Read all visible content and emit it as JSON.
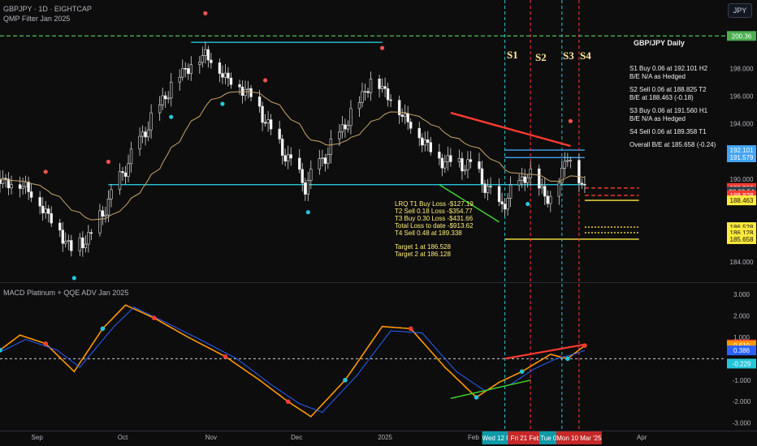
{
  "header": {
    "symbol_line": "GBPJPY · 1D · EIGHTCAP",
    "indicator_line": "QMP Filter Jan 2025",
    "macd_title": "MACD Platinum + QQE ADV Jan 2025",
    "currency_button": "JPY"
  },
  "notes": {
    "title": "GBP/JPY Daily",
    "lines": [
      "S1 Buy 0.06 at 192.101 H2",
      "B/E N/A as Hedged",
      "",
      "S2 Sell 0.06 at 188.825 T2",
      "B/E at 188.463 (-0.18)",
      "",
      "S3 Buy 0.06 at 191.560 H1",
      "B/E N/A as Hedged",
      "",
      "S4 Sell 0.06 at 189.358 T1",
      "",
      "Overall B/E at 185.658 (-0.24)"
    ]
  },
  "loss_box": {
    "lines": [
      "LRQ T1 Buy Loss -$127.19",
      "T2 Sell 0.18 Loss -$354.77",
      "T3 Buy 0.30 Loss -$431.66",
      "Total Loss to date -$913.62",
      "T4 Sell 0.48 at 189.338",
      "",
      "Target 1 at 186.528",
      "Target 2 at 186.128"
    ]
  },
  "signals": [
    "S1",
    "S2",
    "S3",
    "S4"
  ],
  "colors": {
    "up": "#d8d8d8",
    "down": "#ffffff",
    "ema": "#c9a66b",
    "cyan": "#26c6da",
    "red": "#ff3b30",
    "green": "#3ddc2f",
    "yellow": "#ffeb3b",
    "blue_line": "#42a5f5",
    "macd": "#ff9800",
    "signal": "#2962ff"
  },
  "chart_data": [
    {
      "type": "candlestick",
      "title": "GBPJPY · 1D · EIGHTCAP",
      "ylim": [
        183.6,
        201.2
      ],
      "y_ticks": [
        184.0,
        190.0,
        192.0,
        194.0,
        196.0,
        198.0
      ],
      "x_tick_labels": [
        "Sep",
        "Oct",
        "Nov",
        "Dec",
        "2025",
        "Feb",
        "Apr"
      ],
      "x_tick_dates": [
        "2024-09-01",
        "2024-10-01",
        "2024-11-01",
        "2024-12-01",
        "2025-01-01",
        "2025-02-01",
        "2025-04-01"
      ],
      "close_waypoints": [
        {
          "date": "2024-08-19",
          "value": 190.0
        },
        {
          "date": "2024-08-28",
          "value": 189.6
        },
        {
          "date": "2024-09-06",
          "value": 187.2
        },
        {
          "date": "2024-09-13",
          "value": 185.0
        },
        {
          "date": "2024-09-20",
          "value": 186.0
        },
        {
          "date": "2024-10-01",
          "value": 190.5
        },
        {
          "date": "2024-10-10",
          "value": 194.0
        },
        {
          "date": "2024-10-20",
          "value": 197.5
        },
        {
          "date": "2024-10-30",
          "value": 199.2
        },
        {
          "date": "2024-11-06",
          "value": 197.5
        },
        {
          "date": "2024-11-15",
          "value": 196.2
        },
        {
          "date": "2024-11-25",
          "value": 192.5
        },
        {
          "date": "2024-12-04",
          "value": 189.6
        },
        {
          "date": "2024-12-15",
          "value": 193.0
        },
        {
          "date": "2024-12-28",
          "value": 197.5
        },
        {
          "date": "2025-01-10",
          "value": 194.0
        },
        {
          "date": "2025-01-20",
          "value": 191.5
        },
        {
          "date": "2025-02-01",
          "value": 191.0
        },
        {
          "date": "2025-02-10",
          "value": 188.0
        },
        {
          "date": "2025-02-20",
          "value": 190.5
        },
        {
          "date": "2025-02-28",
          "value": 188.5
        },
        {
          "date": "2025-03-06",
          "value": 191.8
        },
        {
          "date": "2025-03-12",
          "value": 189.4
        }
      ],
      "price_labels": [
        {
          "text": "192.101",
          "value": 192.101,
          "color": "#42a5f5"
        },
        {
          "text": "191.579",
          "value": 191.579,
          "color": "#42a5f5"
        },
        {
          "text": "189.360",
          "value": 189.36,
          "color": "#ff3b30"
        },
        {
          "text": "20:09:54",
          "value": 189.1,
          "color": "#3a3e48"
        },
        {
          "text": "188.828",
          "value": 188.828,
          "color": "#ff3b30"
        },
        {
          "text": "188.463",
          "value": 188.463,
          "color": "#ffeb3b"
        },
        {
          "text": "186.528",
          "value": 186.528,
          "color": "#ffeb3b"
        },
        {
          "text": "186.128",
          "value": 186.128,
          "color": "#ffeb3b"
        },
        {
          "text": "185.658",
          "value": 185.658,
          "color": "#ffeb3b"
        },
        {
          "text": "200.36",
          "value": 200.36,
          "color": "#4caf50"
        }
      ],
      "levels": [
        {
          "name": "top-resistance",
          "value": 199.9,
          "from": "2024-10-25",
          "to": "2024-12-31",
          "color": "#26c6da"
        },
        {
          "name": "support",
          "value": 189.6,
          "from": "2024-09-26",
          "to": "2025-03-12",
          "color": "#26c6da"
        },
        {
          "name": "s1-level",
          "value": 192.101,
          "from": "2025-02-12",
          "to": "2025-03-12",
          "color": "#42a5f5"
        },
        {
          "name": "s3-level",
          "value": 191.56,
          "from": "2025-02-12",
          "to": "2025-03-12",
          "color": "#42a5f5"
        },
        {
          "name": "s4-level",
          "value": 189.358,
          "from": "2025-03-12",
          "to": "2025-03-31",
          "color": "#ff3b30"
        },
        {
          "name": "s2-level",
          "value": 188.825,
          "from": "2025-03-12",
          "to": "2025-03-31",
          "color": "#ff3b30"
        },
        {
          "name": "be-level",
          "value": 188.463,
          "from": "2025-03-12",
          "to": "2025-03-31",
          "color": "#ffeb3b"
        },
        {
          "name": "overall-be",
          "value": 185.658,
          "from": "2025-02-12",
          "to": "2025-03-31",
          "color": "#ffeb3b"
        },
        {
          "name": "target-1",
          "value": 186.528,
          "from": "2025-03-12",
          "to": "2025-03-31",
          "color": "#ffeb3b"
        },
        {
          "name": "target-2",
          "value": 186.128,
          "from": "2025-03-12",
          "to": "2025-03-31",
          "color": "#ffeb3b"
        },
        {
          "name": "top-green",
          "value": 200.36,
          "from": "2024-08-19",
          "to": "2025-03-31",
          "color": "#4caf50"
        }
      ],
      "trendlines": [
        {
          "color": "#ff3b30",
          "from": {
            "date": "2025-01-24",
            "value": 194.8
          },
          "to": {
            "date": "2025-03-07",
            "value": 192.4
          }
        },
        {
          "color": "#3ddc2f",
          "from": {
            "date": "2025-01-20",
            "value": 189.6
          },
          "to": {
            "date": "2025-02-10",
            "value": 186.9
          }
        }
      ],
      "dots_top": [
        "2024-09-04",
        "2024-09-26",
        "2024-10-30",
        "2024-11-20",
        "2024-12-31",
        "2025-03-07"
      ],
      "dots_bottom": [
        "2024-09-14",
        "2024-10-18",
        "2024-11-05",
        "2024-12-05",
        "2025-02-20"
      ]
    },
    {
      "type": "line",
      "title": "MACD Platinum + QQE ADV Jan 2025",
      "ylim": [
        -3.2,
        3.3
      ],
      "y_ticks": [
        -3.0,
        -2.0,
        -1.0,
        1.0,
        2.0,
        3.0
      ],
      "series": [
        {
          "name": "MACD",
          "color": "#ff9800",
          "waypoints": [
            {
              "date": "2024-08-19",
              "value": 0.4
            },
            {
              "date": "2024-08-26",
              "value": 1.1
            },
            {
              "date": "2024-09-04",
              "value": 0.7
            },
            {
              "date": "2024-09-14",
              "value": -0.6
            },
            {
              "date": "2024-09-24",
              "value": 1.4
            },
            {
              "date": "2024-10-02",
              "value": 2.5
            },
            {
              "date": "2024-10-12",
              "value": 1.9
            },
            {
              "date": "2024-10-24",
              "value": 1.0
            },
            {
              "date": "2024-11-06",
              "value": 0.1
            },
            {
              "date": "2024-11-18",
              "value": -1.0
            },
            {
              "date": "2024-11-28",
              "value": -2.0
            },
            {
              "date": "2024-12-06",
              "value": -2.7
            },
            {
              "date": "2024-12-18",
              "value": -1.0
            },
            {
              "date": "2024-12-31",
              "value": 1.5
            },
            {
              "date": "2025-01-10",
              "value": 1.4
            },
            {
              "date": "2025-01-22",
              "value": -0.4
            },
            {
              "date": "2025-02-02",
              "value": -1.8
            },
            {
              "date": "2025-02-10",
              "value": -1.1
            },
            {
              "date": "2025-02-18",
              "value": -0.6
            },
            {
              "date": "2025-02-28",
              "value": 0.2
            },
            {
              "date": "2025-03-06",
              "value": 0.0
            },
            {
              "date": "2025-03-12",
              "value": 0.61
            }
          ]
        },
        {
          "name": "Signal",
          "color": "#2962ff",
          "waypoints": [
            {
              "date": "2024-08-19",
              "value": 0.3
            },
            {
              "date": "2024-08-28",
              "value": 0.9
            },
            {
              "date": "2024-09-08",
              "value": 0.4
            },
            {
              "date": "2024-09-16",
              "value": -0.4
            },
            {
              "date": "2024-09-28",
              "value": 1.5
            },
            {
              "date": "2024-10-05",
              "value": 2.4
            },
            {
              "date": "2024-10-16",
              "value": 1.7
            },
            {
              "date": "2024-10-28",
              "value": 0.9
            },
            {
              "date": "2024-11-10",
              "value": 0.0
            },
            {
              "date": "2024-11-22",
              "value": -1.2
            },
            {
              "date": "2024-12-02",
              "value": -2.1
            },
            {
              "date": "2024-12-10",
              "value": -2.5
            },
            {
              "date": "2024-12-22",
              "value": -0.8
            },
            {
              "date": "2025-01-03",
              "value": 1.3
            },
            {
              "date": "2025-01-14",
              "value": 1.2
            },
            {
              "date": "2025-01-26",
              "value": -0.6
            },
            {
              "date": "2025-02-05",
              "value": -1.5
            },
            {
              "date": "2025-02-14",
              "value": -1.2
            },
            {
              "date": "2025-02-22",
              "value": -0.5
            },
            {
              "date": "2025-03-02",
              "value": 0.0
            },
            {
              "date": "2025-03-08",
              "value": 0.2
            },
            {
              "date": "2025-03-12",
              "value": 0.386
            }
          ]
        }
      ],
      "price_labels": [
        {
          "text": "0.661",
          "value": 0.661,
          "color": "#ff3b30"
        },
        {
          "text": "0.610",
          "value": 0.61,
          "color": "#ff9800"
        },
        {
          "text": "0.386",
          "value": 0.386,
          "color": "#2962ff"
        },
        {
          "text": "-0.229",
          "value": -0.229,
          "color": "#26c6da"
        }
      ]
    }
  ],
  "date_tags": [
    {
      "text": "Wed 12 Feb '25",
      "date": "2025-02-12",
      "color": "#0e9aa7"
    },
    {
      "text": "Fri 21 Feb '25",
      "date": "2025-02-21",
      "color": "#c62828"
    },
    {
      "text": "Tue 04 Mar '25",
      "date": "2025-03-04",
      "color": "#0e9aa7"
    },
    {
      "text": "Mon 10 Mar '25",
      "date": "2025-03-10",
      "color": "#c62828"
    }
  ]
}
